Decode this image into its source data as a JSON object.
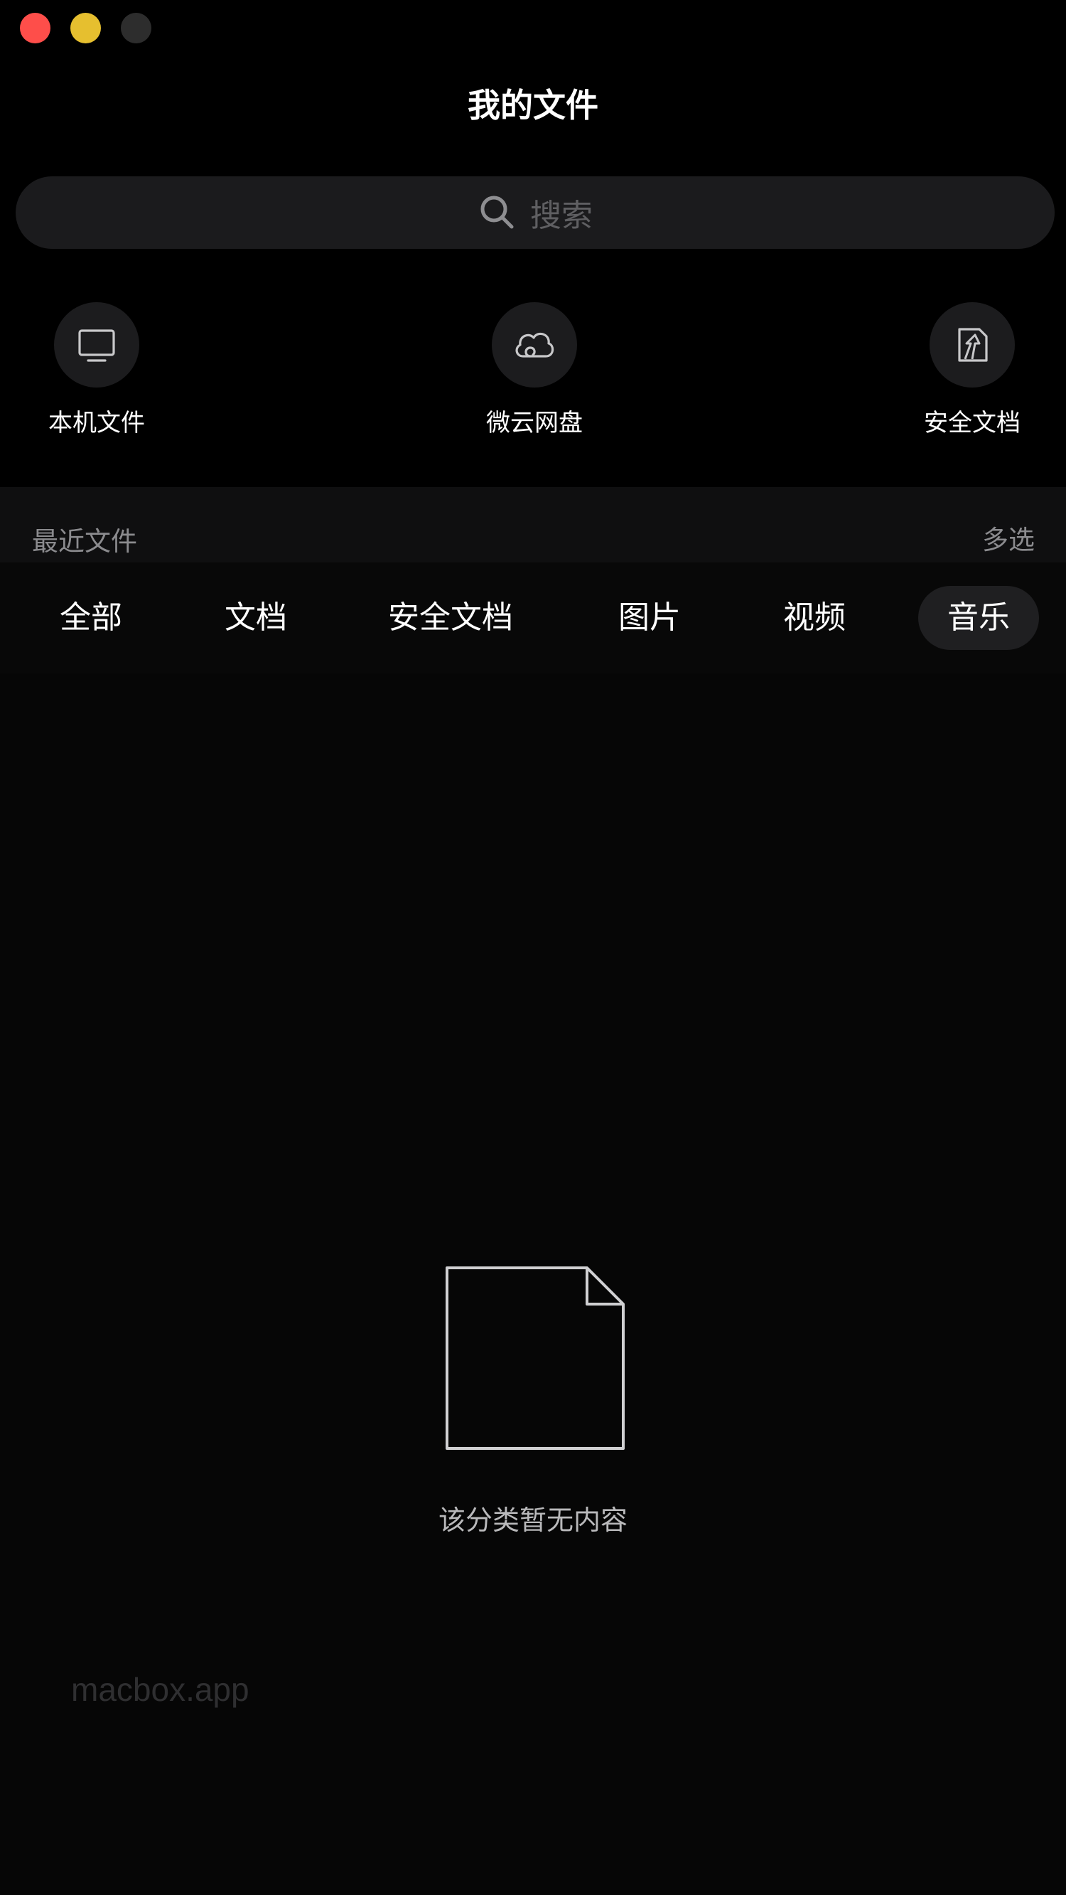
{
  "window": {
    "title": "我的文件"
  },
  "search": {
    "placeholder": "搜索"
  },
  "quick_access": [
    {
      "label": "本机文件",
      "icon": "monitor-icon"
    },
    {
      "label": "微云网盘",
      "icon": "cloud-icon"
    },
    {
      "label": "安全文档",
      "icon": "secure-document-icon"
    }
  ],
  "recent": {
    "title": "最近文件",
    "multi_select": "多选"
  },
  "tabs": [
    {
      "label": "全部",
      "active": false
    },
    {
      "label": "文档",
      "active": false
    },
    {
      "label": "安全文档",
      "active": false
    },
    {
      "label": "图片",
      "active": false
    },
    {
      "label": "视频",
      "active": false
    },
    {
      "label": "音乐",
      "active": true
    }
  ],
  "empty_state": {
    "icon": "blank-document-icon",
    "message": "该分类暂无内容"
  },
  "watermark": "macbox.app",
  "colors": {
    "close": "#fe4e4a",
    "minimize": "#e6bf2f",
    "zoom_disabled": "#2d2d2d",
    "background": "#000000",
    "active_tab": "#1f1f21"
  }
}
